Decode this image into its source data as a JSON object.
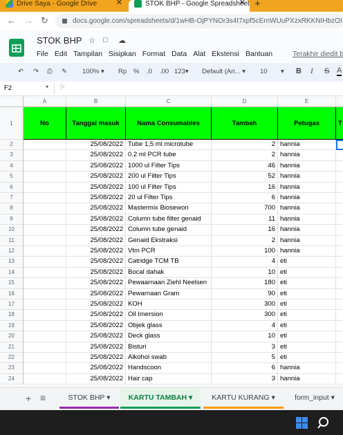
{
  "browser": {
    "tabs": [
      {
        "title": "Drive Saya - Google Drive",
        "close": "✕"
      },
      {
        "title": "STOK BHP - Google Spreadsheet",
        "close": "✕"
      }
    ],
    "new_tab": "+",
    "url": "docs.google.com/spreadsheets/d/1wHB-OjPYNOr3s4t7xpf5cErnWUuPXzxRKKNIHbzOI"
  },
  "sheets": {
    "doc_title": "STOK BHP",
    "menu": [
      "File",
      "Edit",
      "Tampilan",
      "Sisipkan",
      "Format",
      "Data",
      "Alat",
      "Ekstensi",
      "Bantuan"
    ],
    "last_edit": "Terakhir diedit b",
    "toolbar": {
      "zoom": "100%",
      "currency": "Rp",
      "percent": "%",
      "dec_decrease": ".0",
      "dec_increase": ".00",
      "more_formats": "123",
      "font": "Default (Ari...",
      "font_size": "10",
      "bold": "B",
      "italic": "I",
      "strike": "S",
      "text_color": "A"
    },
    "name_box": "F2",
    "fx": "fx",
    "columns": [
      "A",
      "B",
      "C",
      "D",
      "E"
    ],
    "header_row": {
      "num": "1",
      "cells": [
        "No",
        "Tanggal masuk",
        "Nama Consumables",
        "Tambah",
        "Petugas",
        "T"
      ]
    },
    "rows": [
      {
        "n": "2",
        "date": "25/08/2022",
        "name": "Tube 1,5 ml microtube",
        "qty": "2",
        "staff": "hannia"
      },
      {
        "n": "3",
        "date": "25/08/2022",
        "name": "0.2 ml PCR tube",
        "qty": "2",
        "staff": "hannia"
      },
      {
        "n": "4",
        "date": "25/08/2022",
        "name": "1000 ul Filter Tips",
        "qty": "46",
        "staff": "hannia"
      },
      {
        "n": "5",
        "date": "25/08/2022",
        "name": "200 ul Filter Tips",
        "qty": "52",
        "staff": "hannia"
      },
      {
        "n": "6",
        "date": "25/08/2022",
        "name": "100 ul Filter Tips",
        "qty": "16",
        "staff": "hannia"
      },
      {
        "n": "7",
        "date": "25/08/2022",
        "name": "20 ul Filter Tips",
        "qty": "6",
        "staff": "hannia"
      },
      {
        "n": "8",
        "date": "25/08/2022",
        "name": "Mastermix Biosewon",
        "qty": "700",
        "staff": "hannia"
      },
      {
        "n": "9",
        "date": "25/08/2022",
        "name": "Column tube filter genaid",
        "qty": "11",
        "staff": "hannia"
      },
      {
        "n": "10",
        "date": "25/08/2022",
        "name": "Column tube genaid",
        "qty": "16",
        "staff": "hannia"
      },
      {
        "n": "11",
        "date": "25/08/2022",
        "name": "Genaid Ekstraksi",
        "qty": "2",
        "staff": "hannia"
      },
      {
        "n": "12",
        "date": "25/08/2022",
        "name": "Vtm PCR",
        "qty": "100",
        "staff": "hannia"
      },
      {
        "n": "13",
        "date": "25/08/2022",
        "name": "Catridge TCM TB",
        "qty": "4",
        "staff": "eti"
      },
      {
        "n": "14",
        "date": "25/08/2022",
        "name": "Bocal dahak",
        "qty": "10",
        "staff": "eti"
      },
      {
        "n": "15",
        "date": "25/08/2022",
        "name": "Pewaarnaan Ziehl Neelsen",
        "qty": "180",
        "staff": "eti"
      },
      {
        "n": "16",
        "date": "25/08/2022",
        "name": "Pewarnaan Gram",
        "qty": "90",
        "staff": "eti"
      },
      {
        "n": "17",
        "date": "25/08/2022",
        "name": "KOH",
        "qty": "300",
        "staff": "eti"
      },
      {
        "n": "18",
        "date": "25/08/2022",
        "name": "Oil Imersion",
        "qty": "300",
        "staff": "eti"
      },
      {
        "n": "19",
        "date": "25/08/2022",
        "name": "Objek glass",
        "qty": "4",
        "staff": "eti"
      },
      {
        "n": "20",
        "date": "25/08/2022",
        "name": "Deck glass",
        "qty": "10",
        "staff": "eti"
      },
      {
        "n": "21",
        "date": "25/08/2022",
        "name": "Bisturi",
        "qty": "3",
        "staff": "eti"
      },
      {
        "n": "22",
        "date": "25/08/2022",
        "name": "Alkohol swab",
        "qty": "5",
        "staff": "eti"
      },
      {
        "n": "23",
        "date": "25/08/2022",
        "name": "Handscoon",
        "qty": "6",
        "staff": "hannia"
      },
      {
        "n": "24",
        "date": "25/08/2022",
        "name": "Hair cap",
        "qty": "3",
        "staff": "hannia"
      }
    ],
    "sheet_tabs": [
      {
        "label": "STOK BHP",
        "active": false,
        "color": "#9c27b0"
      },
      {
        "label": "KARTU TAMBAH",
        "active": true,
        "color": "#0f9d58"
      },
      {
        "label": "KARTU KURANG",
        "active": false,
        "color": "#ff9800"
      },
      {
        "label": "form_input",
        "active": false,
        "color": ""
      }
    ],
    "add_sheet": "+",
    "all_sheets": "≡"
  },
  "colors": {
    "header_fill": "#00ff00",
    "chrome_tab_strip": "#f0a31f",
    "sheets_green": "#0f9d58",
    "taskbar": "#1e1e1e"
  }
}
